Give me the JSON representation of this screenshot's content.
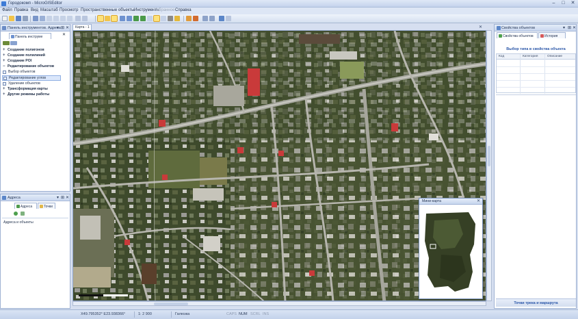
{
  "window": {
    "title": "Городокомп - MicroGISEditor",
    "controls": [
      "–",
      "□",
      "✕"
    ]
  },
  "menu": [
    {
      "label": "Файл",
      "enabled": true
    },
    {
      "label": "Правка",
      "enabled": true
    },
    {
      "label": "Вид",
      "enabled": true
    },
    {
      "label": "Масштаб",
      "enabled": true
    },
    {
      "label": "Просмотр",
      "enabled": true
    },
    {
      "label": "Пространственные объекты",
      "enabled": true
    },
    {
      "label": "Инструменты",
      "enabled": true
    },
    {
      "label": "Избранное",
      "enabled": false
    },
    {
      "label": "Справка",
      "enabled": true
    }
  ],
  "left_panel": {
    "title": "Панель инструментов. Адреса",
    "tab_label": "Панель инструме",
    "items": [
      {
        "label": "Создание полигонов",
        "kind": "group"
      },
      {
        "label": "Создание полилиний",
        "kind": "group"
      },
      {
        "label": "Создание POI",
        "kind": "group"
      },
      {
        "label": "Редактирование объектов",
        "kind": "group"
      },
      {
        "label": "Выбор объектов",
        "kind": "sub"
      },
      {
        "label": "Редактирование углов",
        "kind": "sub",
        "selected": true
      },
      {
        "label": "Удаление объектов",
        "kind": "sub"
      },
      {
        "label": "Трансформация карты",
        "kind": "group"
      },
      {
        "label": "Другие режимы работы",
        "kind": "group"
      }
    ]
  },
  "address_panel": {
    "title": "Адреса",
    "tabs": [
      "Адреса",
      "Точки"
    ],
    "link": "Адреса и объекты"
  },
  "document_tab": "Карта - 1",
  "minimap": {
    "title": "Мини-карта"
  },
  "right_panel": {
    "title": "Свойства объектов",
    "tabs": [
      "Свойства объектов",
      "История"
    ],
    "heading": "Выбор типа в свойства объекта",
    "columns": [
      "Код",
      "Категория",
      "Описание"
    ],
    "footer": "Точки трека и маршрута"
  },
  "status": {
    "coords": "X49.795352° E23.938366°",
    "scale": "1: 2 900",
    "mode": "Галюзка",
    "caps": "CAPS",
    "num": "NUM",
    "scrl": "SCRL",
    "ins": "INS"
  }
}
